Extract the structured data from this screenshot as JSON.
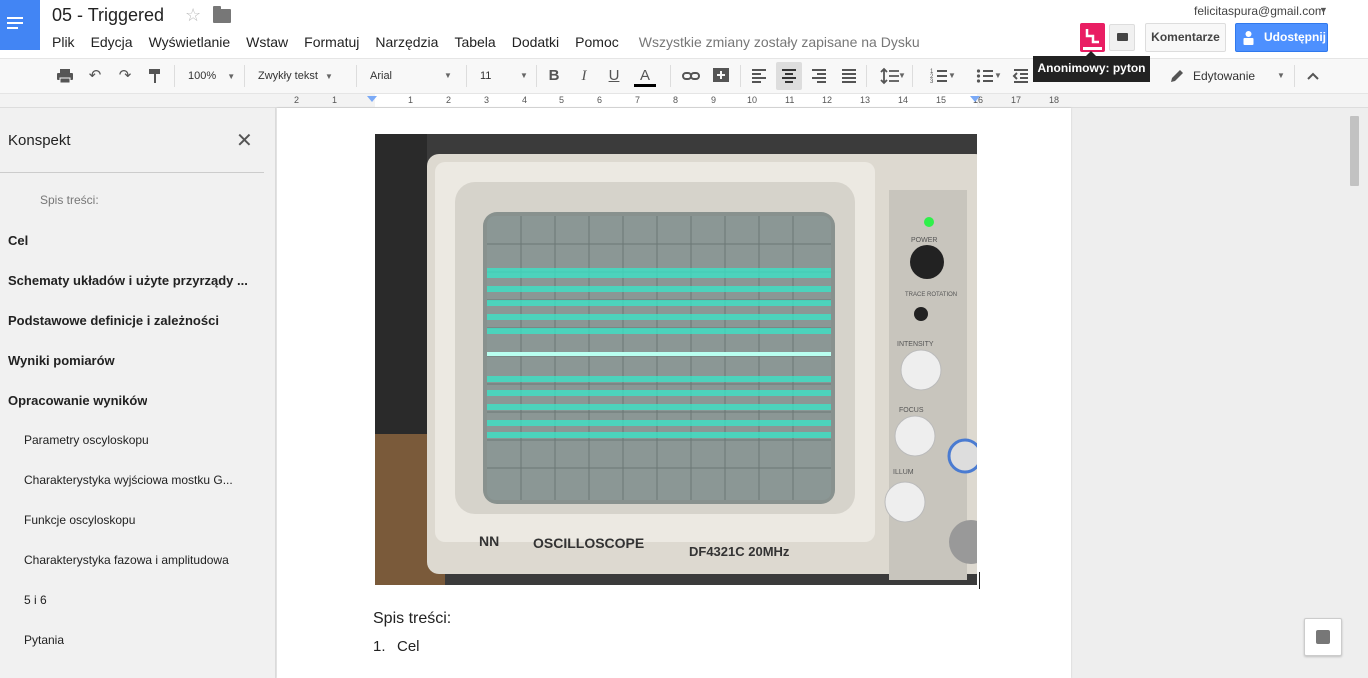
{
  "app": {
    "doc_title": "05 - Triggered",
    "user_email": "felicitaspura@gmail.com"
  },
  "menu": {
    "items": [
      "Plik",
      "Edycja",
      "Wyświetlanie",
      "Wstaw",
      "Formatuj",
      "Narzędzia",
      "Tabela",
      "Dodatki",
      "Pomoc"
    ],
    "save_status": "Wszystkie zmiany zostały zapisane na Dysku"
  },
  "header": {
    "comments_label": "Komentarze",
    "share_label": "Udostępnij",
    "tooltip": "Anonimowy: pyton",
    "avatar_color": "#e91e63",
    "share_color": "#4d90fe"
  },
  "toolbar": {
    "zoom": "100%",
    "style": "Zwykły tekst",
    "font": "Arial",
    "size": "11",
    "text_color": "#000000",
    "mode_label": "Edytowanie"
  },
  "ruler": {
    "numbers": [
      "2",
      "1",
      "1",
      "1",
      "2",
      "3",
      "4",
      "5",
      "6",
      "7",
      "8",
      "9",
      "10",
      "11",
      "12",
      "13",
      "14",
      "15",
      "16",
      "17",
      "18"
    ]
  },
  "outline": {
    "title": "Konspekt",
    "items": [
      {
        "label": "Spis treści:",
        "level": "muted"
      },
      {
        "label": "Cel",
        "level": "h1"
      },
      {
        "label": "Schematy układów i użyte przyrządy ...",
        "level": "h1"
      },
      {
        "label": "Podstawowe definicje i zależności",
        "level": "h1"
      },
      {
        "label": "Wyniki pomiarów",
        "level": "h1"
      },
      {
        "label": "Opracowanie wyników",
        "level": "h1"
      },
      {
        "label": "Parametry oscyloskopu",
        "level": "h2"
      },
      {
        "label": "Charakterystyka wyjściowa mostku G...",
        "level": "h2"
      },
      {
        "label": "Funkcje oscyloskopu",
        "level": "h2"
      },
      {
        "label": "Charakterystyka fazowa i amplitudowa",
        "level": "h2"
      },
      {
        "label": "5 i 6",
        "level": "h2"
      },
      {
        "label": "Pytania",
        "level": "h2"
      }
    ]
  },
  "document": {
    "photo": {
      "brand": "NN",
      "model_label": "OSCILLOSCOPE",
      "model_number": "DF4321C  20MHz",
      "trace_color": "#37e7c9",
      "panel_labels": [
        "POWER",
        "TRACE ROTATION",
        "INTENSITY",
        "FOCUS",
        "ILLUM"
      ]
    },
    "toc_heading": "Spis treści:",
    "toc_items": [
      {
        "num": "1.",
        "label": "Cel"
      }
    ]
  }
}
